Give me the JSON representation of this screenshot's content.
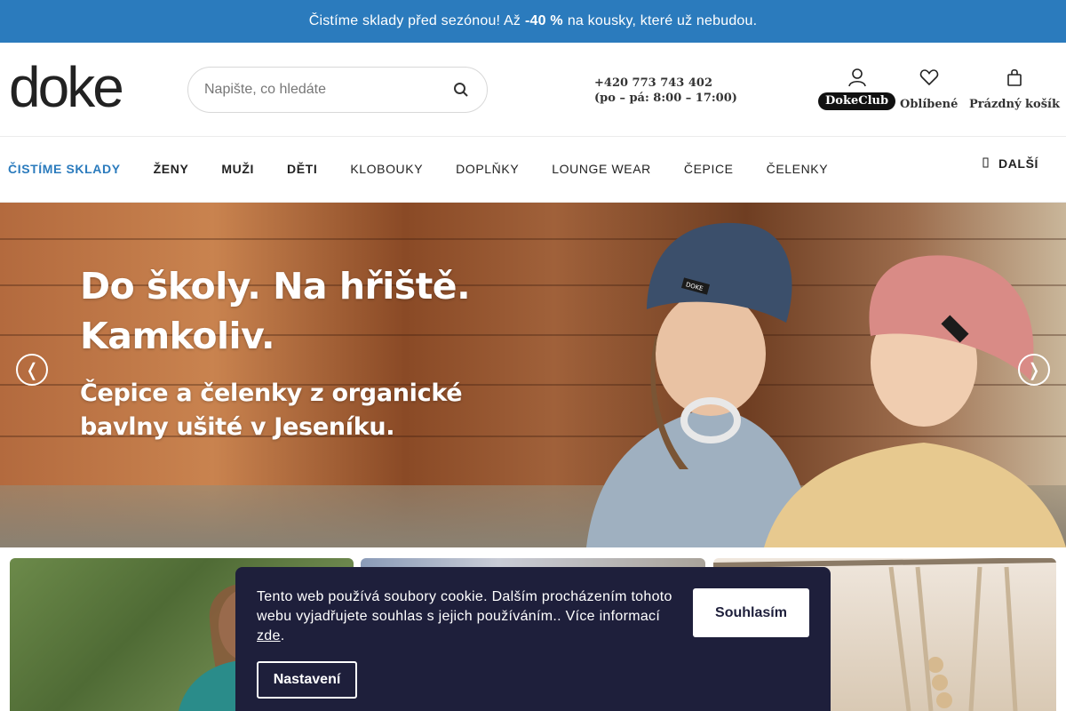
{
  "promo": {
    "text_before": "Čistíme sklady před sezónou! Až",
    "highlight": "-40 %",
    "text_after": "na kousky, které už nebudou."
  },
  "header": {
    "logo": "doke",
    "search_placeholder": "Napište, co hledáte",
    "search_icon": "search-icon",
    "phone": "+420 773 743 402",
    "hours": "(po – pá: 8:00 – 17:00)",
    "club_label_plain": "Doke",
    "club_label_bold": "Club",
    "favorites_label": "Oblíbené",
    "cart_label": "Prázdný košík"
  },
  "nav": {
    "items": [
      {
        "label": "ČISTÍME SKLADY"
      },
      {
        "label": "ŽENY"
      },
      {
        "label": "MUŽI"
      },
      {
        "label": "DĚTI"
      },
      {
        "label": "KLOBOUKY"
      },
      {
        "label": "DOPLŇKY"
      },
      {
        "label": "LOUNGE WEAR"
      },
      {
        "label": "ČEPICE"
      },
      {
        "label": "ČELENKY"
      }
    ],
    "more_label": "DALŠÍ"
  },
  "hero": {
    "headline_line1": "Do školy. Na hřiště.",
    "headline_line2": "Kamkoliv.",
    "sub_line1": "Čepice a čelenky z organické",
    "sub_line2": "bavlny ušité v Jeseníku.",
    "prev_symbol": "❬",
    "next_symbol": "❭",
    "beanie_tag": "DOKE"
  },
  "cookie": {
    "text": "Tento web používá soubory cookie. Dalším procházením tohoto webu vyjadřujete souhlas s jejich používáním.. Více informací",
    "link_text": "zde",
    "after_link": ".",
    "agree_label": "Souhlasím",
    "settings_label": "Nastavení"
  },
  "colors": {
    "promo_bg": "#2b7bbd",
    "accent": "#2b7bbd",
    "cookie_bg": "#1e1f3b"
  }
}
